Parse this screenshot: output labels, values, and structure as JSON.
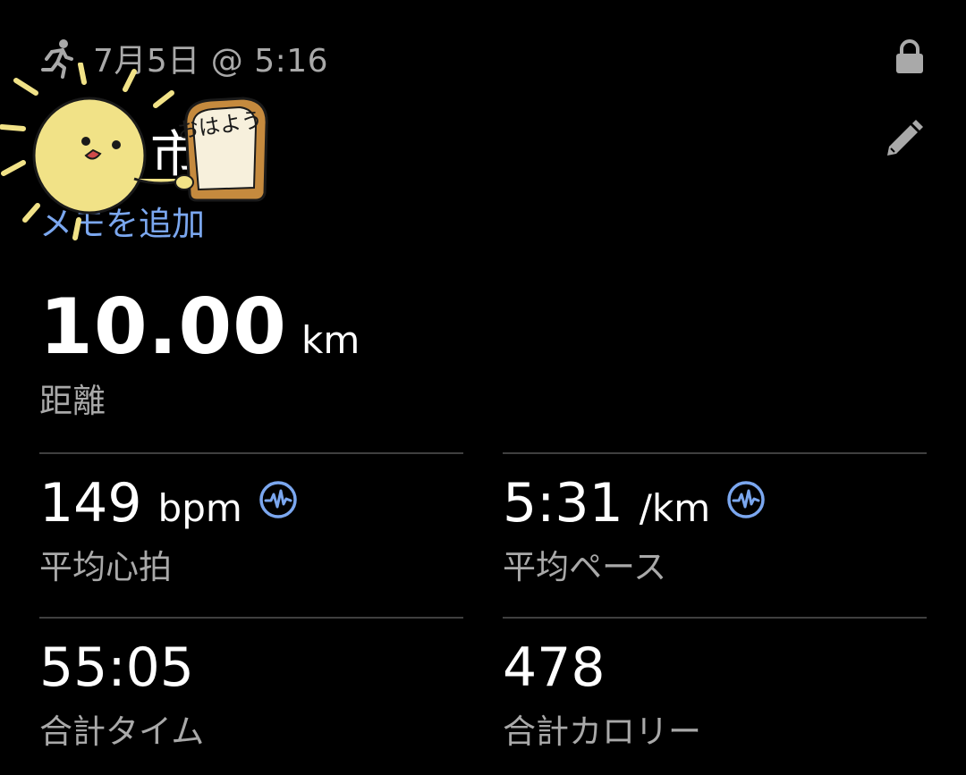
{
  "header": {
    "date_time": "7月5日 @ 5:16",
    "activity_type_icon": "running-person-icon",
    "lock_icon": "lock-icon",
    "edit_icon": "pencil-icon"
  },
  "activity": {
    "title_visible": "市 ン",
    "add_memo_label": "メモを追加"
  },
  "sticker": {
    "text": "おはよう",
    "description_icon": "sun-with-bread-sticker"
  },
  "distance": {
    "value": "10.00",
    "unit": "km",
    "label": "距離"
  },
  "stats": [
    {
      "value": "149",
      "unit": "bpm",
      "label": "平均心拍",
      "icon": "heart-rate-icon"
    },
    {
      "value": "5:31",
      "unit": "/km",
      "label": "平均ペース",
      "icon": "heart-rate-icon"
    },
    {
      "value": "55:05",
      "unit": "",
      "label": "合計タイム"
    },
    {
      "value": "478",
      "unit": "",
      "label": "合計カロリー"
    }
  ],
  "colors": {
    "background": "#000000",
    "primary_text": "#ffffff",
    "secondary_text": "#a9a9a9",
    "accent_link": "#7ba7ef",
    "divider": "#3f3f3f"
  }
}
